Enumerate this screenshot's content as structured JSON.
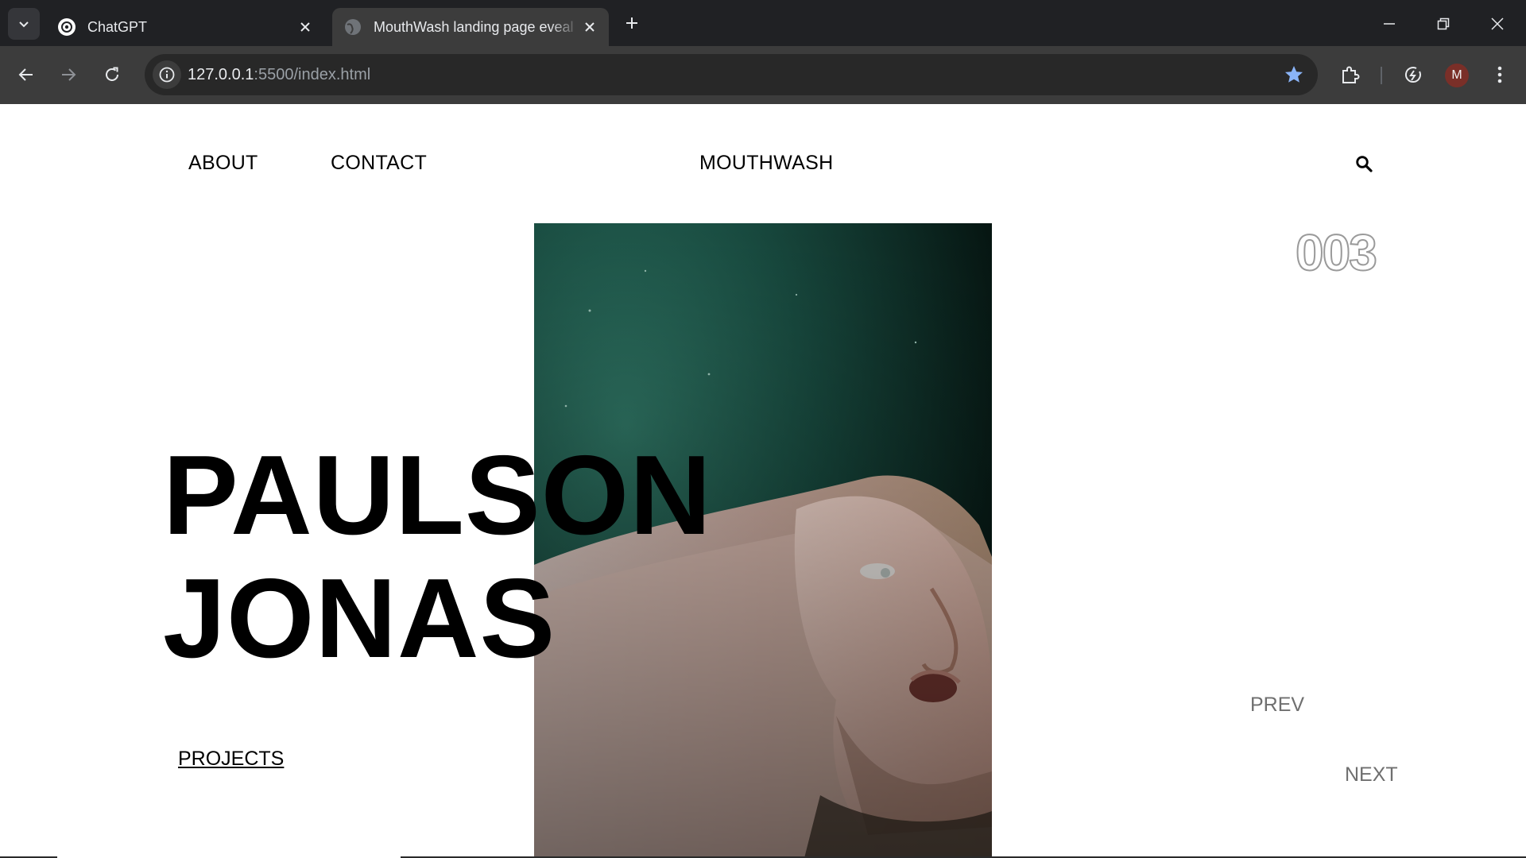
{
  "browser": {
    "tabs": [
      {
        "title": "ChatGPT",
        "icon": "chatgpt-icon",
        "active": false
      },
      {
        "title": "MouthWash landing page eveal",
        "icon": "globe-icon",
        "active": true
      }
    ],
    "address": {
      "host": "127.0.0.1",
      "port": ":5500",
      "path": "/index.html"
    },
    "profile_initial": "M",
    "colors": {
      "tabbar": "#202124",
      "toolbar": "#3c3c3c",
      "omnibox": "#282828",
      "star": "#8ab4f8",
      "avatar": "#7a2f28"
    }
  },
  "site": {
    "nav": {
      "about": "ABOUT",
      "contact": "CONTACT",
      "brand": "MOUTHWASH"
    },
    "counter": "003",
    "headline": {
      "line1": "PAULSON",
      "line2": "JONAS"
    },
    "projects_link": "PROJECTS",
    "prev_label": "PREV",
    "next_label": "NEXT",
    "colors": {
      "text": "#000000",
      "muted": "#6f6f6f",
      "counter_outline": "#9a9a9a",
      "photo_teal": "#1f5a4e"
    }
  }
}
